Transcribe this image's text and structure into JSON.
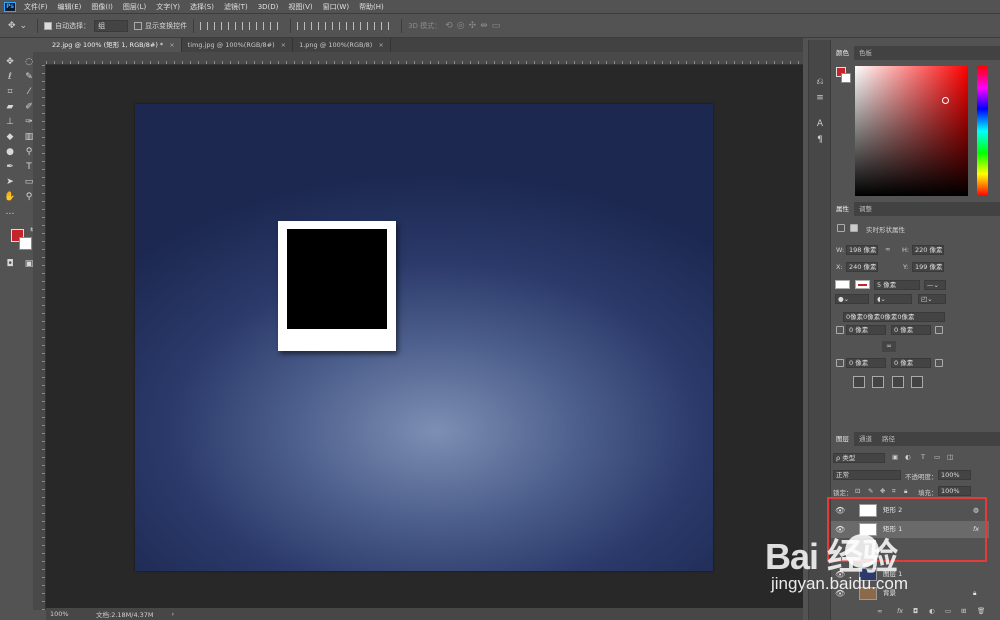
{
  "app": {
    "logo": "Ps"
  },
  "menu": [
    "文件(F)",
    "编辑(E)",
    "图像(I)",
    "图层(L)",
    "文字(Y)",
    "选择(S)",
    "滤镜(T)",
    "3D(D)",
    "视图(V)",
    "窗口(W)",
    "帮助(H)"
  ],
  "options": {
    "auto_select_label": "自动选择：",
    "auto_select_value": "组",
    "show_transform_label": "显示变换控件",
    "mode3d_label": "3D 模式："
  },
  "tabs": [
    {
      "label": "22.jpg @ 100% (矩形 1, RGB/8#) *",
      "active": true
    },
    {
      "label": "timg.jpg @ 100%(RGB/8#)",
      "active": false
    },
    {
      "label": "1.png @ 100%(RGB/8)",
      "active": false
    }
  ],
  "tab_close": "×",
  "status": {
    "zoom": "100%",
    "doc_info": "文档:2.18M/4.37M",
    "arrow": "›"
  },
  "color_panel": {
    "tabs": [
      "颜色",
      "色板"
    ],
    "fg_color": "#c4252a",
    "bg_color": "#ffffff"
  },
  "properties": {
    "tabs": [
      "属性",
      "调整"
    ],
    "title": "实时形状属性",
    "w_label": "W:",
    "w_value": "198 像素",
    "h_label": "H:",
    "h_value": "220 像素",
    "x_label": "X:",
    "x_value": "240 像素",
    "y_label": "Y:",
    "y_value": "199 像素",
    "stroke_size": "5 像素",
    "corner_all": "0像素0像素0像素0像素",
    "corner_tl": "0 像素",
    "corner_tr": "0 像素",
    "corner_bl": "0 像素",
    "corner_br": "0 像素"
  },
  "layers": {
    "tabs": [
      "图层",
      "通道",
      "路径"
    ],
    "filter_label": "ρ 类型",
    "blend_mode": "正常",
    "opacity_label": "不透明度：",
    "opacity_value": "100%",
    "lock_label": "锁定：",
    "fill_label": "填充：",
    "fill_value": "100%",
    "rows": [
      {
        "name": "矩形 2",
        "selected": false
      },
      {
        "name": "矩形 1",
        "selected": true,
        "fx": "fx"
      },
      {
        "name": "图层 1",
        "selected": false
      },
      {
        "name": "背景",
        "selected": false
      }
    ]
  },
  "watermark": {
    "brand": "Bai  经验",
    "url": "jingyan.baidu.com"
  }
}
